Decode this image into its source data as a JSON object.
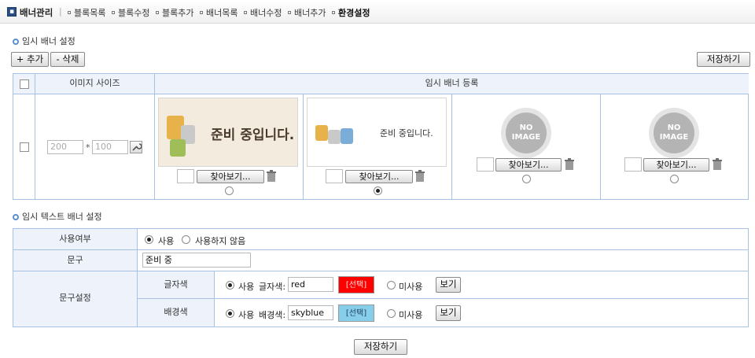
{
  "nav": {
    "header_icon": "admin-box-icon",
    "title": "배너관리",
    "separator": "|",
    "items": [
      {
        "label": "블록목록"
      },
      {
        "label": "블록수정"
      },
      {
        "label": "블록추가"
      },
      {
        "label": "배너목록"
      },
      {
        "label": "배너수정"
      },
      {
        "label": "배너추가"
      },
      {
        "label": "환경설정",
        "active": true
      }
    ]
  },
  "temp_banner": {
    "section_title": "임시 배너 설정",
    "add_button": "+ 추가",
    "delete_button": "- 삭제",
    "save_button": "저장하기",
    "col_size": "이미지 사이즈",
    "col_register": "임시 배너 등록",
    "row": {
      "checked": false,
      "width_placeholder": "200",
      "height_placeholder": "100",
      "times": "*",
      "slots": [
        {
          "image": "preparing-image-large",
          "caption": "준비 중입니다.",
          "browse_label": "찾아보기...",
          "selected": false
        },
        {
          "image": "preparing-image-small",
          "caption": "준비 중입니다.",
          "browse_label": "찾아보기...",
          "selected": true
        },
        {
          "image": "no-image",
          "caption": "NO IMAGE",
          "browse_label": "찾아보기...",
          "selected": false
        },
        {
          "image": "no-image",
          "caption": "NO IMAGE",
          "browse_label": "찾아보기...",
          "selected": false
        }
      ]
    }
  },
  "text_banner": {
    "section_title": "임시 텍스트 배너 설정",
    "usage_label": "사용여부",
    "usage_options": [
      {
        "label": "사용",
        "selected": true
      },
      {
        "label": "사용하지 않음",
        "selected": false
      }
    ],
    "phrase_label": "문구",
    "phrase_value": "준비 중",
    "phrase_settings_label": "문구설정",
    "font_color": {
      "label": "글자색",
      "use_label": "사용",
      "field_label": "글자색:",
      "value": "red",
      "select_label": "[선택]",
      "swatch_color": "#ff0000",
      "unused_label": "미사용",
      "view_button": "보기"
    },
    "bg_color": {
      "label": "배경색",
      "use_label": "사용",
      "field_label": "배경색:",
      "value": "skyblue",
      "select_label": "[선택]",
      "swatch_color": "#87ceeb",
      "unused_label": "미사용",
      "view_button": "보기"
    },
    "save_button": "저장하기"
  },
  "colors": {
    "border": "#a7c1e5",
    "header_bg": "#eef3fb",
    "accent": "#5a8fd0"
  }
}
